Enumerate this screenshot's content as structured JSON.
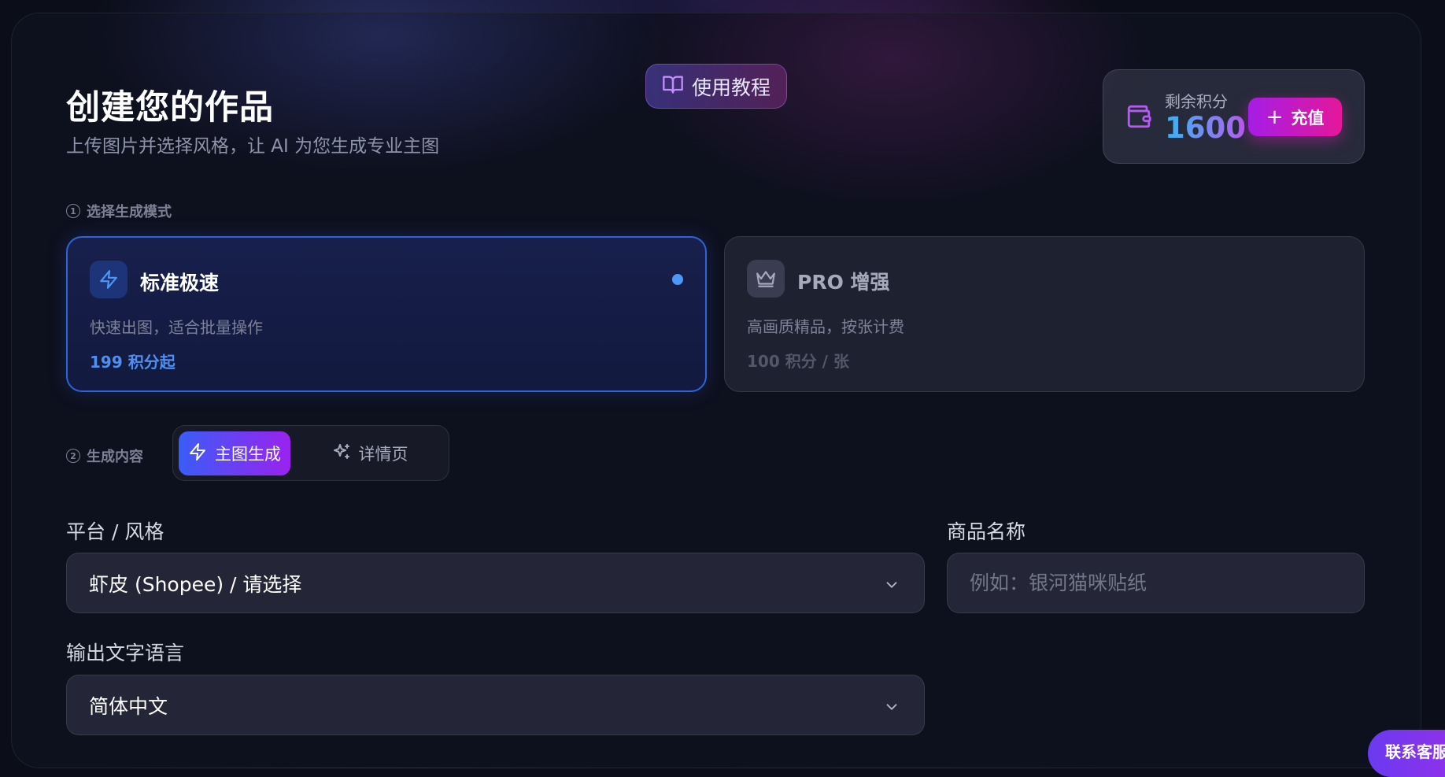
{
  "header": {
    "title": "创建您的作品",
    "subtitle": "上传图片并选择风格，让 AI 为您生成专业主图",
    "tutorial_label": "使用教程"
  },
  "credits": {
    "label": "剩余积分",
    "value": "1600",
    "recharge_label": "充值"
  },
  "step1": {
    "number": "1",
    "label": "选择生成模式"
  },
  "modes": [
    {
      "name": "标准极速",
      "description": "快速出图，适合批量操作",
      "price": "199 积分起",
      "selected": true,
      "icon": "lightning-icon"
    },
    {
      "name": "PRO 增强",
      "description": "高画质精品，按张计费",
      "price": "100 积分 / 张",
      "selected": false,
      "icon": "crown-icon"
    }
  ],
  "step2": {
    "number": "2",
    "label": "生成内容",
    "tabs": [
      {
        "label": "主图生成",
        "icon": "lightning-icon",
        "active": true
      },
      {
        "label": "详情页",
        "icon": "sparkles-icon",
        "active": false
      }
    ]
  },
  "form": {
    "platform": {
      "label": "平台 / 风格",
      "value": "虾皮 (Shopee) / 请选择"
    },
    "product_name": {
      "label": "商品名称",
      "placeholder": "例如：银河猫咪贴纸"
    },
    "language": {
      "label": "输出文字语言",
      "value": "简体中文"
    }
  },
  "floating_button": {
    "label": "联系客服"
  },
  "colors": {
    "background": "#0b0d18",
    "accent_blue": "#3163d6",
    "accent_purple": "#9a22ef",
    "accent_pink": "#e5179a",
    "price_blue": "#4f8ff0"
  }
}
